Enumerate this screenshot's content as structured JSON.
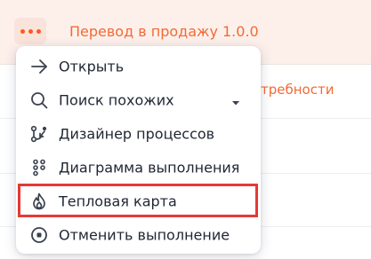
{
  "row_selected": {
    "title": "Перевод в продажу 1.0.0",
    "more_icon": "more-horizontal-icon"
  },
  "row_behind": {
    "text": "требности"
  },
  "menu": {
    "items": [
      {
        "label": "Открыть",
        "icon": "arrow-right-icon"
      },
      {
        "label": "Поиск похожих",
        "icon": "search-icon",
        "has_submenu": true
      },
      {
        "label": "Дизайнер процессов",
        "icon": "process-designer-icon"
      },
      {
        "label": "Диаграмма выполнения",
        "icon": "execution-diagram-icon"
      },
      {
        "label": "Тепловая карта",
        "icon": "flame-icon",
        "highlighted": true
      },
      {
        "label": "Отменить выполнение",
        "icon": "stop-circle-icon"
      }
    ]
  },
  "colors": {
    "accent": "#ff5a1f",
    "accent_text": "#f26a35",
    "selected_row_bg": "#fdf0eb",
    "highlight_border": "#e53935",
    "menu_text": "#1f2633",
    "icon": "#3a4150"
  }
}
